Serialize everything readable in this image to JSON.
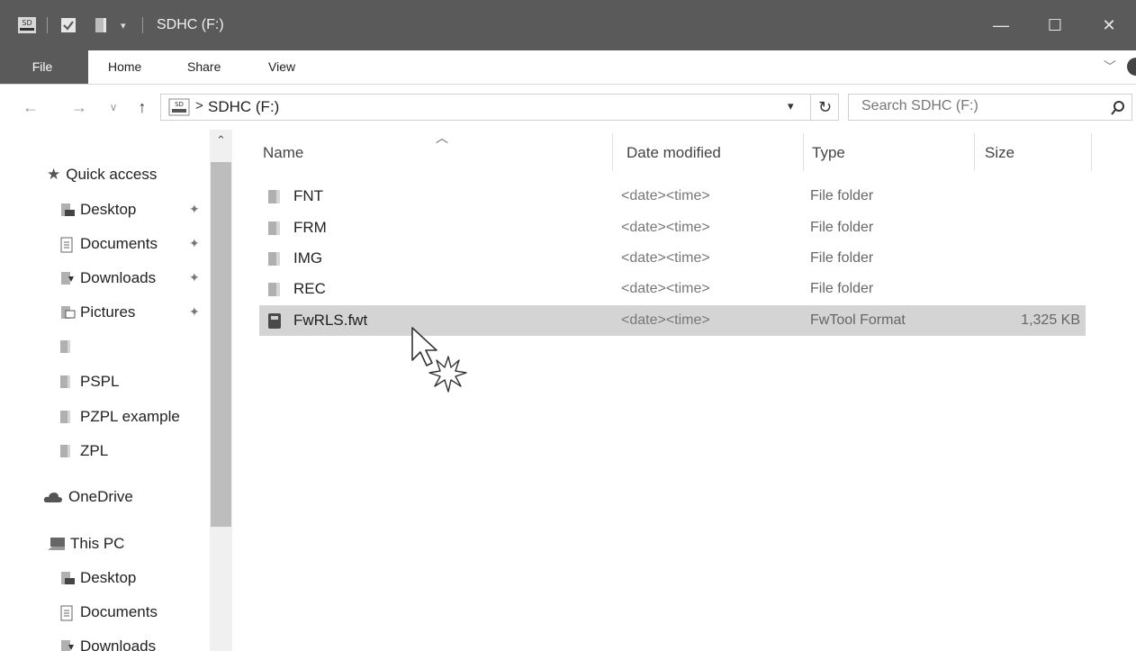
{
  "window": {
    "title": "SDHC (F:)",
    "controls": {
      "minimize": "—",
      "maximize": "☐",
      "close": "✕"
    }
  },
  "ribbon": {
    "tabs": [
      "File",
      "Home",
      "Share",
      "View"
    ]
  },
  "address": {
    "drive_icon_text": "SD",
    "separator": ">",
    "path": "SDHC (F:)",
    "search_placeholder": "Search SDHC (F:)"
  },
  "sidebar": {
    "quick_access": "Quick access",
    "quick_items": [
      {
        "label": "Desktop",
        "icon": "desktop-folder-icon",
        "pinned": true
      },
      {
        "label": "Documents",
        "icon": "documents-folder-icon",
        "pinned": true
      },
      {
        "label": "Downloads",
        "icon": "downloads-folder-icon",
        "pinned": true
      },
      {
        "label": "Pictures",
        "icon": "pictures-folder-icon",
        "pinned": true
      },
      {
        "label": "",
        "icon": "folder-icon",
        "pinned": false
      },
      {
        "label": "PSPL",
        "icon": "folder-icon",
        "pinned": false
      },
      {
        "label": "PZPL example",
        "icon": "folder-icon",
        "pinned": false
      },
      {
        "label": "ZPL",
        "icon": "folder-icon",
        "pinned": false
      }
    ],
    "onedrive": "OneDrive",
    "this_pc": "This PC",
    "pc_items": [
      {
        "label": "Desktop",
        "icon": "desktop-folder-icon"
      },
      {
        "label": "Documents",
        "icon": "documents-folder-icon"
      },
      {
        "label": "Downloads",
        "icon": "downloads-folder-icon"
      }
    ]
  },
  "list": {
    "columns": {
      "name": "Name",
      "date": "Date modified",
      "type": "Type",
      "size": "Size"
    },
    "rows": [
      {
        "name": "FNT",
        "date": "<date><time>",
        "type": "File folder",
        "size": "",
        "icon": "folder-icon",
        "selected": false
      },
      {
        "name": "FRM",
        "date": "<date><time>",
        "type": "File folder",
        "size": "",
        "icon": "folder-icon",
        "selected": false
      },
      {
        "name": "IMG",
        "date": "<date><time>",
        "type": "File folder",
        "size": "",
        "icon": "folder-icon",
        "selected": false
      },
      {
        "name": "REC",
        "date": "<date><time>",
        "type": "File folder",
        "size": "",
        "icon": "folder-icon",
        "selected": false
      },
      {
        "name": "FwRLS.fwt",
        "date": "<date><time>",
        "type": "FwTool Format",
        "size": "1,325 KB",
        "icon": "fwt-file-icon",
        "selected": true
      }
    ]
  }
}
